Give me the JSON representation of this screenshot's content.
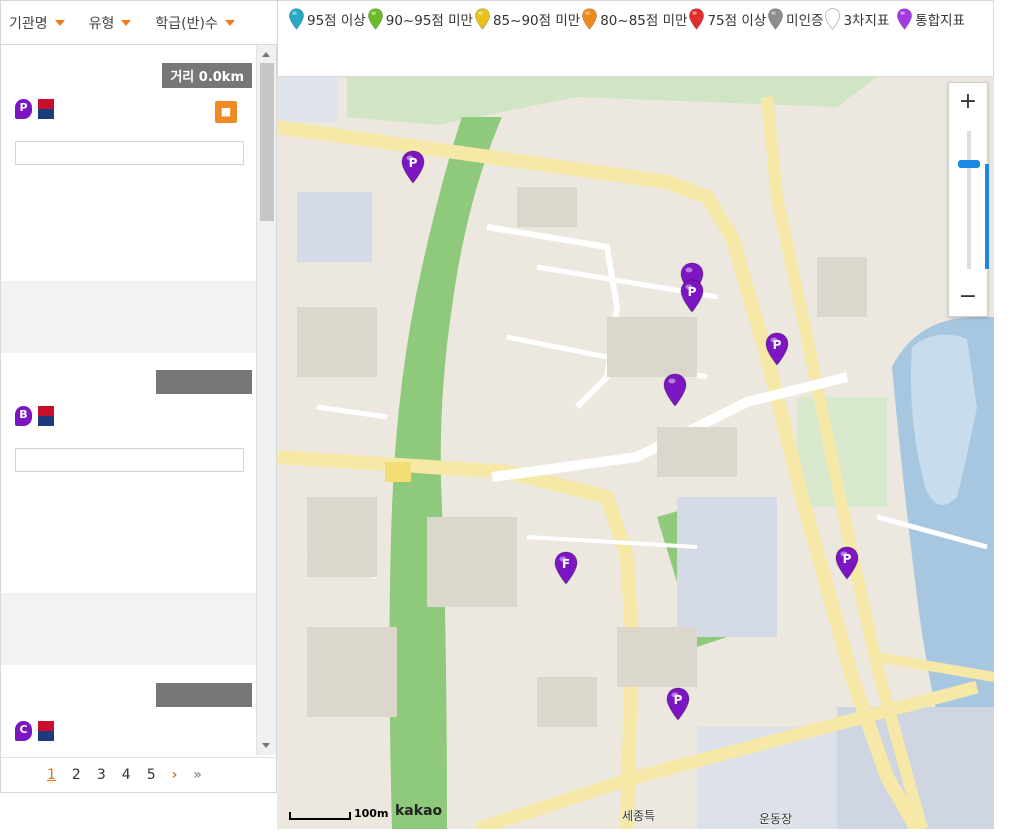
{
  "filters": [
    {
      "label": "기관명"
    },
    {
      "label": "유형"
    },
    {
      "label": "학급(반)수"
    }
  ],
  "legend": [
    {
      "label": "95점 이상",
      "color": "#2aa6c7"
    },
    {
      "label": "90~95점 미만",
      "color": "#6cbb2b"
    },
    {
      "label": "85~90점 미만",
      "color": "#e7c21a"
    },
    {
      "label": "80~85점 미만",
      "color": "#ee8b1e"
    },
    {
      "label": "75점 이상",
      "color": "#e02d2d"
    },
    {
      "label": "미인증",
      "color": "#8d8d8d"
    },
    {
      "label": "3차지표",
      "color": "#ffffff"
    },
    {
      "label": "통합지표",
      "color": "#a43be0"
    }
  ],
  "list": {
    "cards": [
      {
        "distance": "거리 0.0km",
        "badge": "P",
        "name": "",
        "phone": "",
        "desc": "",
        "stats": [
          "",
          "",
          "",
          ""
        ]
      },
      {
        "distance": "",
        "badge": "B",
        "name": "",
        "phone": "",
        "desc": "",
        "stats": [
          "",
          "",
          "",
          ""
        ]
      },
      {
        "distance": "",
        "badge": "C",
        "name": "",
        "phone": "",
        "desc": "",
        "stats": []
      }
    ]
  },
  "pagination": {
    "pages": [
      "1",
      "2",
      "3",
      "4",
      "5"
    ],
    "next": "›",
    "last": "»"
  },
  "map": {
    "zoom_in": "+",
    "zoom_out": "−",
    "zoom_level": 0.76,
    "scale": "100m",
    "logo": "kakao",
    "labels": [
      "세종특",
      "운동장"
    ],
    "pins": [
      {
        "letter": "P",
        "color": "#7b16c2"
      },
      {
        "letter": "",
        "color": "#7b16c2"
      },
      {
        "letter": "P",
        "color": "#7b16c2"
      },
      {
        "letter": "P",
        "color": "#7b16c2"
      },
      {
        "letter": "",
        "color": "#7b16c2"
      },
      {
        "letter": "F",
        "color": "#7b16c2"
      },
      {
        "letter": "P",
        "color": "#7b16c2"
      },
      {
        "letter": "P",
        "color": "#7b16c2"
      }
    ]
  }
}
